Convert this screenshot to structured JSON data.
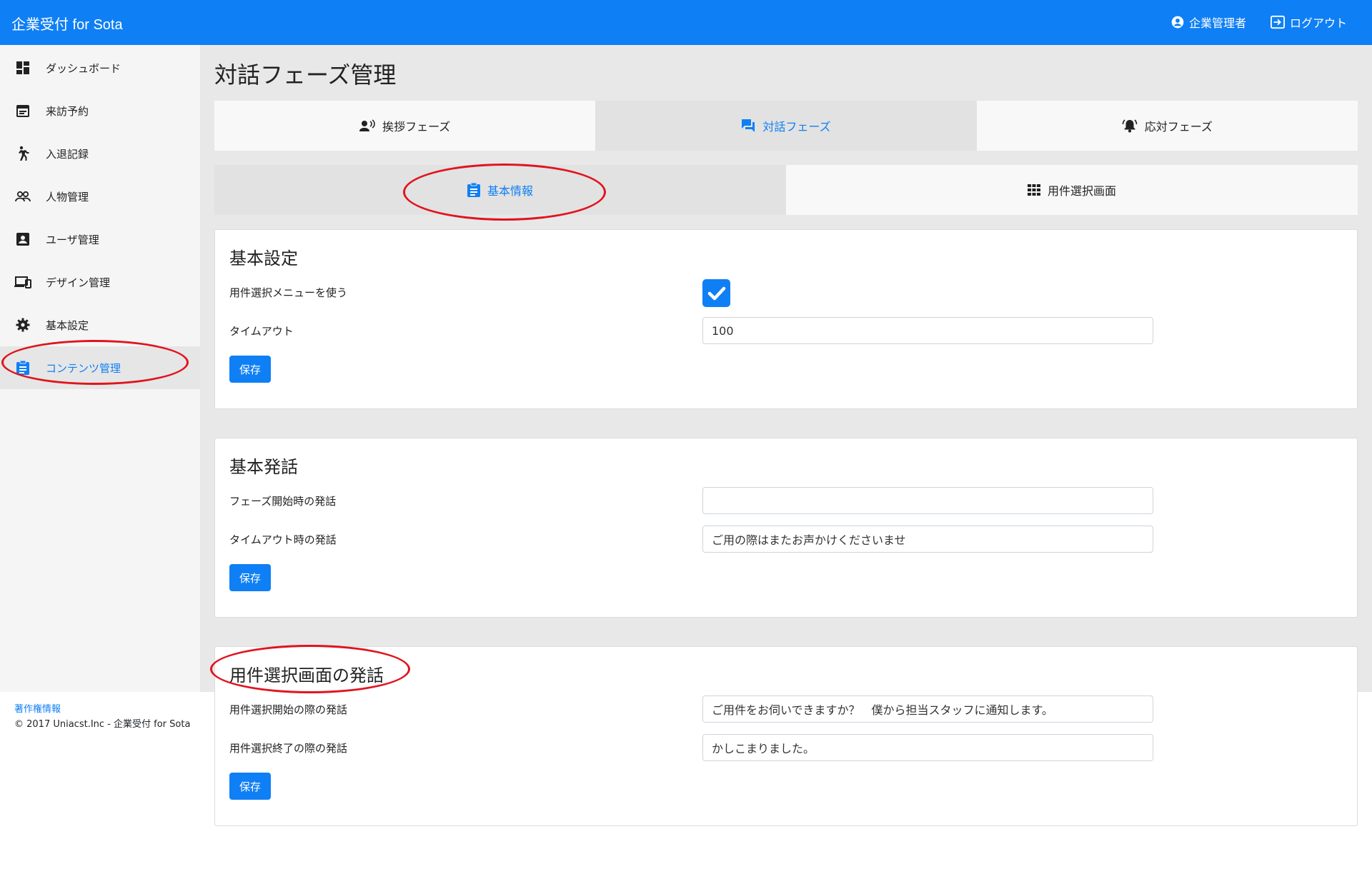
{
  "header": {
    "brand": "企業受付 for Sota",
    "user_label": "企業管理者",
    "logout_label": "ログアウト"
  },
  "sidebar": {
    "items": [
      {
        "label": "ダッシュボード",
        "icon": "dashboard-icon"
      },
      {
        "label": "来訪予約",
        "icon": "calendar-icon"
      },
      {
        "label": "入退記録",
        "icon": "walking-person-icon"
      },
      {
        "label": "人物管理",
        "icon": "people-icon"
      },
      {
        "label": "ユーザ管理",
        "icon": "account-box-icon"
      },
      {
        "label": "デザイン管理",
        "icon": "devices-icon"
      },
      {
        "label": "基本設定",
        "icon": "gear-icon"
      },
      {
        "label": "コンテンツ管理",
        "icon": "clipboard-icon",
        "active": true
      }
    ],
    "footer_link": "著作権情報",
    "footer_text": "© 2017 Uniacst.Inc - 企業受付 for Sota"
  },
  "main": {
    "title": "対話フェーズ管理",
    "phase_tabs": [
      {
        "label": "挨拶フェーズ",
        "icon": "voice-person-icon"
      },
      {
        "label": "対話フェーズ",
        "icon": "chat-icon",
        "active": true
      },
      {
        "label": "応対フェーズ",
        "icon": "bell-icon"
      }
    ],
    "sub_tabs": [
      {
        "label": "基本情報",
        "icon": "clipboard-icon",
        "active": true
      },
      {
        "label": "用件選択画面",
        "icon": "grid-icon"
      }
    ],
    "basic_settings": {
      "title": "基本設定",
      "use_menu_label": "用件選択メニューを使う",
      "use_menu_checked": true,
      "timeout_label": "タイムアウト",
      "timeout_value": "100",
      "save_label": "保存"
    },
    "basic_speech": {
      "title": "基本発話",
      "phase_start_label": "フェーズ開始時の発話",
      "phase_start_value": "",
      "timeout_speech_label": "タイムアウト時の発話",
      "timeout_speech_value": "ご用の際はまたお声かけくださいませ",
      "save_label": "保存"
    },
    "selection_speech": {
      "title": "用件選択画面の発話",
      "start_label": "用件選択開始の際の発話",
      "start_value": "ご用件をお伺いできますか？　僕から担当スタッフに通知します。",
      "end_label": "用件選択終了の際の発話",
      "end_value": "かしこまりました。",
      "save_label": "保存"
    }
  },
  "colors": {
    "primary": "#0f7ff5",
    "annotation": "#e0141e"
  }
}
